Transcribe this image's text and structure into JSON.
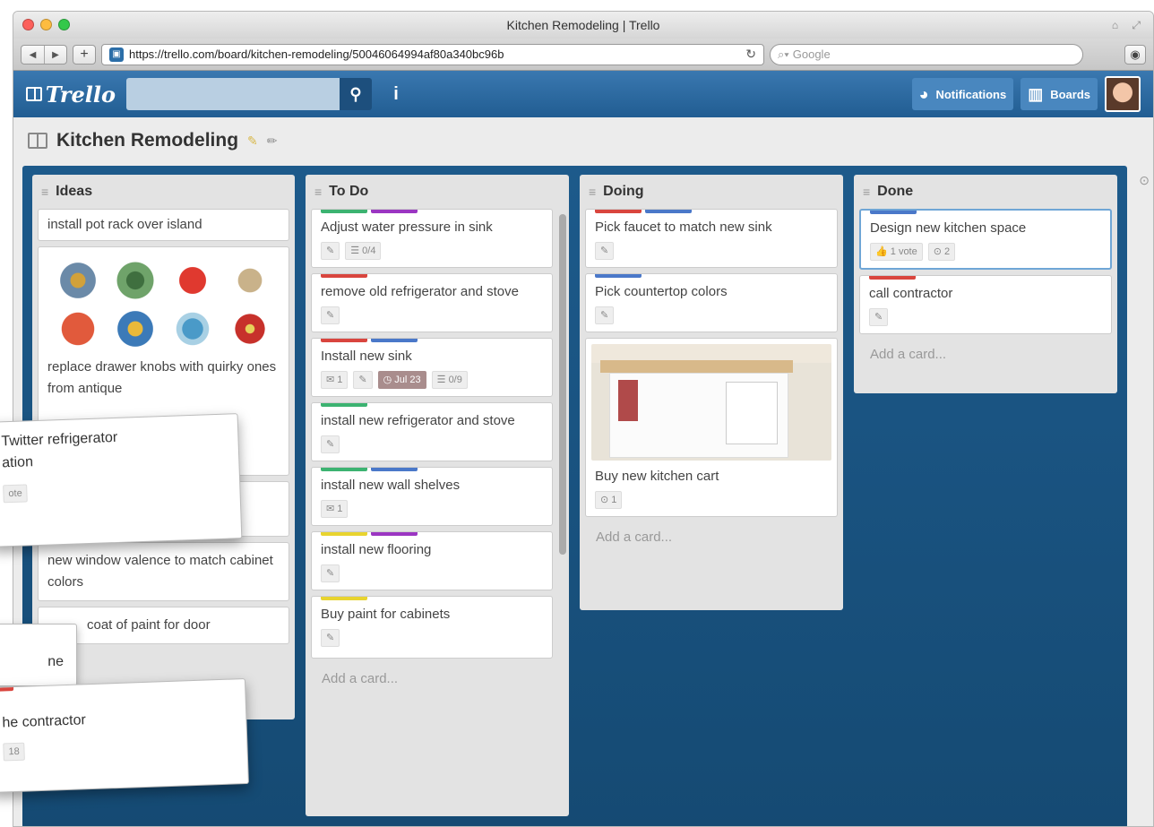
{
  "window": {
    "title": "Kitchen Remodeling | Trello"
  },
  "browser": {
    "url": "https://trello.com/board/kitchen-remodeling/50046064994af80a340bc96b",
    "search_placeholder": "Google"
  },
  "header": {
    "logo": "Trello",
    "notifications_label": "Notifications",
    "boards_label": "Boards"
  },
  "board": {
    "title": "Kitchen Remodeling"
  },
  "colors": {
    "green": "#3cb371",
    "purple": "#9b36c2",
    "red": "#d9453e",
    "blue": "#4a78c9",
    "yellow": "#e8d42f"
  },
  "lists": [
    {
      "title": "Ideas",
      "cards": [
        {
          "text": "install pot rack over island"
        },
        {
          "text": "replace drawer knobs with quirky ones from antique"
        },
        {
          "text": "new window valence to match cabinet colors"
        },
        {
          "text": "coat of paint for door"
        }
      ]
    },
    {
      "title": "To Do",
      "cards": [
        {
          "text": "Adjust water pressure in sink",
          "checklist": "0/4"
        },
        {
          "text": "remove old refrigerator and stove"
        },
        {
          "text": "Install new sink",
          "comments": "1",
          "due": "Jul 23",
          "checklist": "0/9"
        },
        {
          "text": "install new refrigerator and stove"
        },
        {
          "text": "install new wall shelves",
          "comments": "1"
        },
        {
          "text": "install new flooring"
        },
        {
          "text": "Buy paint for cabinets"
        }
      ],
      "add": "Add a card..."
    },
    {
      "title": "Doing",
      "cards": [
        {
          "text": "Pick faucet to match new sink"
        },
        {
          "text": "Pick countertop colors"
        },
        {
          "text": "Buy new kitchen cart",
          "attachments": "1"
        }
      ],
      "add": "Add a card..."
    },
    {
      "title": "Done",
      "cards": [
        {
          "text": "Design new kitchen space",
          "votes": "1 vote",
          "attachments": "2"
        },
        {
          "text": "call contractor"
        }
      ],
      "add": "Add a card..."
    }
  ],
  "floating": {
    "twitter_line1": "Twitter refrigerator",
    "twitter_line2": "ation",
    "twitter_badge": "ote",
    "contractor_text": "he contractor",
    "contractor_badge": "18",
    "door_partial": "ne"
  }
}
